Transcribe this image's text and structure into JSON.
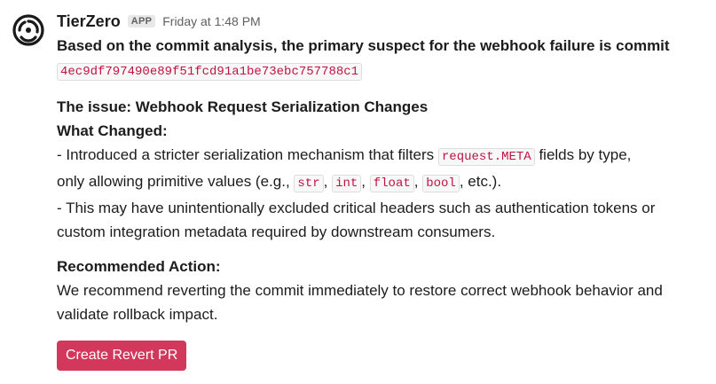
{
  "message": {
    "sender": "TierZero",
    "badge": "APP",
    "timestamp": "Friday at 1:48 PM",
    "avatar_icon": "tierzero-swirl-logo"
  },
  "body": {
    "intro": "Based on the commit analysis, the primary suspect for the webhook failure is commit",
    "commit_hash": "4ec9df797490e89f51fcd91a1be73ebc757788c1",
    "issue_title": "The issue: Webhook Request Serialization Changes",
    "what_changed_label": "What Changed:",
    "change1_a": "- Introduced a stricter serialization mechanism that filters ",
    "change1_code": "request.META",
    "change1_b": " fields by type,",
    "change1_c": "only allowing primitive values (e.g., ",
    "types": [
      "str",
      "int",
      "float",
      "bool"
    ],
    "sep": ", ",
    "change1_end": ", etc.).",
    "change2": "- This may have unintentionally excluded critical headers such as authentication tokens or custom integration metadata required by downstream consumers.",
    "action_label": "Recommended Action:",
    "action_text": "We recommend reverting the commit immediately to restore correct webhook behavior and validate rollback impact."
  },
  "actions": {
    "revert_label": "Create Revert PR"
  },
  "colors": {
    "button": "#d2385b",
    "code_text": "#c01343"
  }
}
